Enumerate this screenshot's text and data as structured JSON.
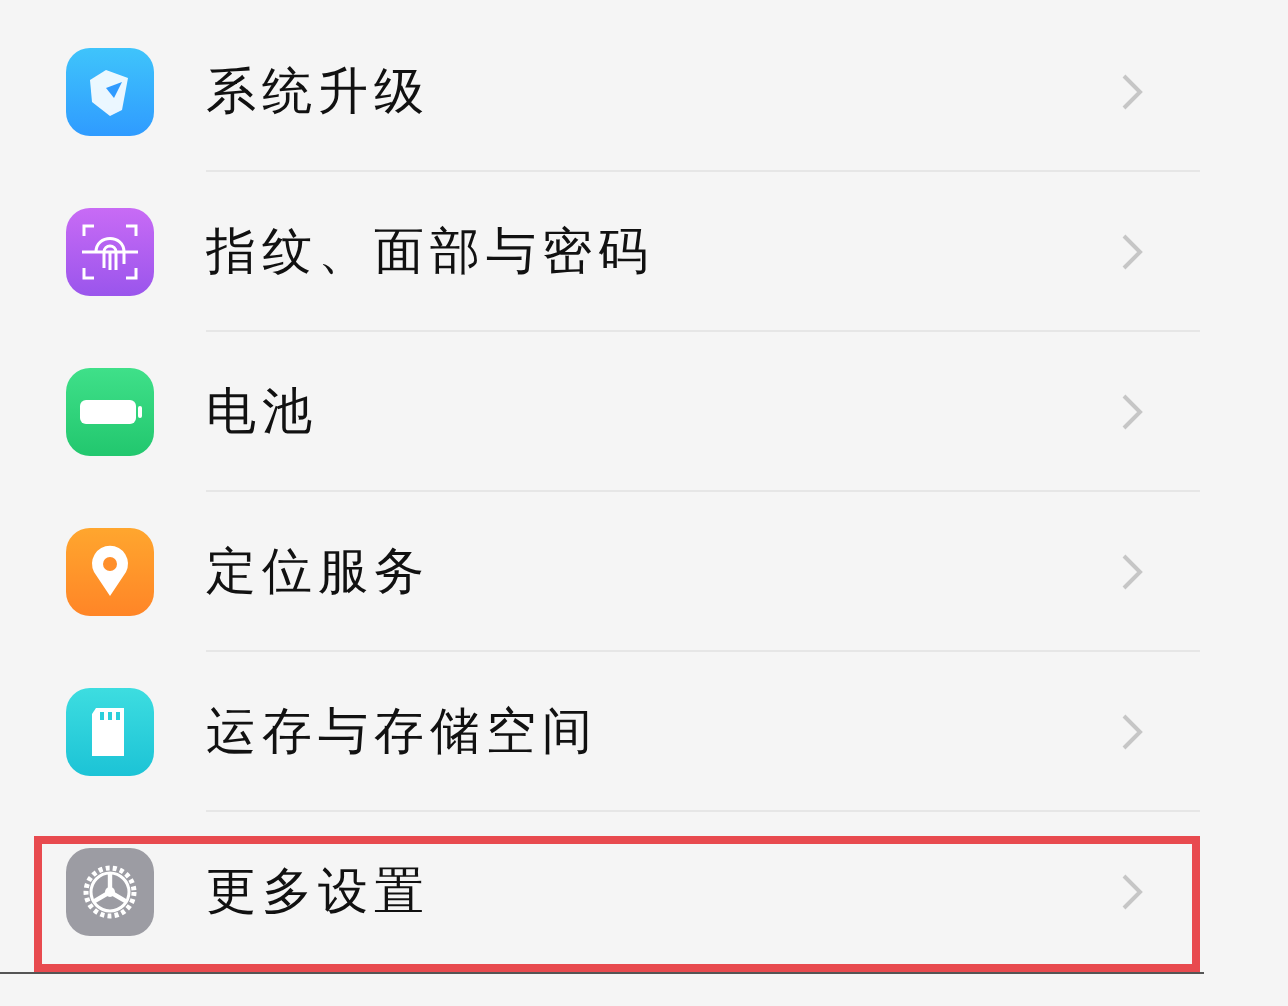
{
  "settings_items": [
    {
      "kind": "update",
      "label": "系统升级",
      "highlighted": false
    },
    {
      "kind": "fingerprint",
      "label": "指纹、面部与密码",
      "highlighted": false
    },
    {
      "kind": "battery",
      "label": "电池",
      "highlighted": false
    },
    {
      "kind": "location",
      "label": "定位服务",
      "highlighted": false
    },
    {
      "kind": "storage",
      "label": "运存与存储空间",
      "highlighted": false
    },
    {
      "kind": "gear",
      "label": "更多设置",
      "highlighted": true
    }
  ]
}
